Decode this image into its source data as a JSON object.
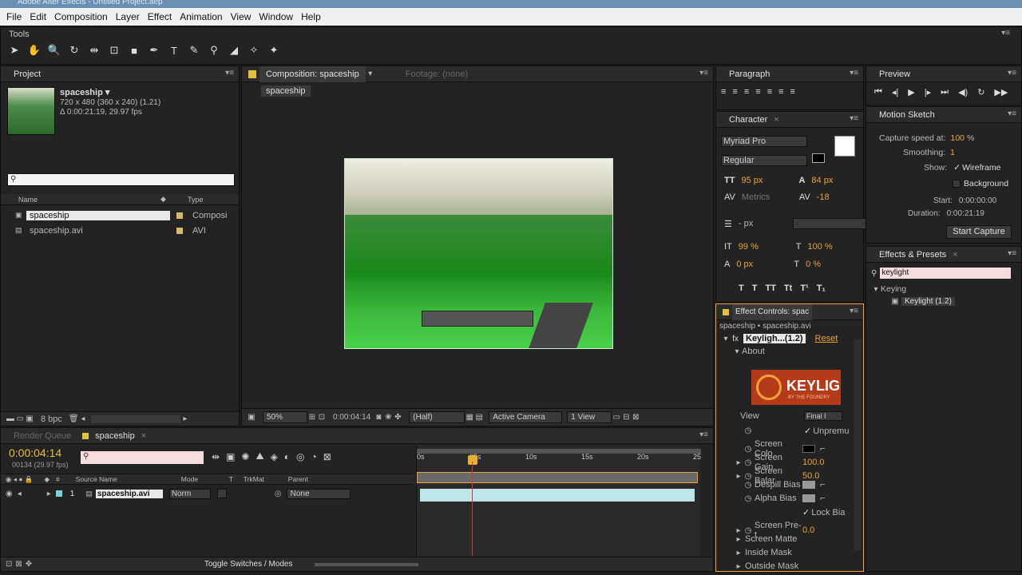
{
  "app": {
    "title": "Adobe After Effects - Untitled Project.aep"
  },
  "menu": [
    "File",
    "Edit",
    "Composition",
    "Layer",
    "Effect",
    "Animation",
    "View",
    "Window",
    "Help"
  ],
  "tools": {
    "title": "Tools"
  },
  "project": {
    "tab": "Project",
    "item_name": "spaceship ▾",
    "item_info1": "720 x 480  (360 x 240) (1.21)",
    "item_info2": "Δ 0:00:21:19, 29.97 fps",
    "search_icon": "search-icon",
    "col_name": "Name",
    "col_type": "Type",
    "rows": [
      {
        "name": "spaceship",
        "type": "Composi"
      },
      {
        "name": "spaceship.avi",
        "type": "AVI"
      }
    ],
    "bpc": "8 bpc"
  },
  "comp": {
    "tab": "Composition: spaceship",
    "footage_tab": "Footage: (none)",
    "crumb": "spaceship",
    "zoom": "50%",
    "timecode": "0:00:04:14",
    "resolution": "(Half)",
    "camera": "Active Camera",
    "view": "1 View"
  },
  "paragraph": {
    "tab": "Paragraph"
  },
  "character": {
    "tab": "Character",
    "font": "Myriad Pro",
    "style": "Regular",
    "size": "95 px",
    "leading": "84 px",
    "kerning": "Metrics",
    "tracking": "-18",
    "stroke": "- px",
    "vscale": "99 %",
    "hscale": "100 %",
    "baseline": "0 px",
    "tsume": "0 %",
    "styles": [
      "T",
      "T",
      "TT",
      "Tt",
      "T¹",
      "T₁"
    ]
  },
  "effect_controls": {
    "tab": "Effect Controls: spac",
    "crumb": "spaceship • spaceship.avi",
    "fx_name": "Keyligh...(1.2)",
    "reset": "Reset",
    "about": "About",
    "logo": "KEYLIG",
    "logo_sub": "BY THE FOUNDRY",
    "view_label": "View",
    "view_value": "Final I",
    "unpremultiply": "Unpremu",
    "rows": [
      {
        "label": "Screen Colo",
        "value": ""
      },
      {
        "label": "Screen Gain",
        "value": "100.0"
      },
      {
        "label": "Screen Balar",
        "value": "50.0"
      },
      {
        "label": "Despill Bias",
        "value": ""
      },
      {
        "label": "Alpha Bias",
        "value": ""
      }
    ],
    "lock_bias": "Lock Bia",
    "screen_pre": "Screen Pre-t",
    "screen_pre_value": "0.0",
    "screen_matte": "Screen Matte",
    "inside_mask": "Inside Mask",
    "outside_mask": "Outside Mask"
  },
  "preview": {
    "tab": "Preview"
  },
  "motion_sketch": {
    "tab": "Motion Sketch",
    "capture_label": "Capture speed at:",
    "capture_value": "100",
    "capture_unit": "%",
    "smoothing_label": "Smoothing:",
    "smoothing_value": "1",
    "show_label": "Show:",
    "wireframe": "Wireframe",
    "background": "Background",
    "start_label": "Start:",
    "start_value": "0:00:00:00",
    "duration_label": "Duration:",
    "duration_value": "0:00:21:19",
    "button": "Start Capture"
  },
  "effects_presets": {
    "tab": "Effects & Presets",
    "search": "keylight",
    "group": "Keying",
    "item": "Keylight (1.2)"
  },
  "timeline": {
    "render_tab": "Render Queue",
    "comp_tab": "spaceship",
    "timecode": "0:00:04:14",
    "frames": "00134 (29.97 fps)",
    "col_source": "Source Name",
    "col_mode": "Mode",
    "col_t": "T",
    "col_trkmat": "TrkMat",
    "col_parent": "Parent",
    "layer_num": "1",
    "layer_name": "spaceship.avi",
    "layer_mode": "Norm",
    "layer_parent": "None",
    "ruler": [
      "0s",
      "05s",
      "10s",
      "15s",
      "20s",
      "25"
    ],
    "toggle": "Toggle Switches / Modes",
    "hash": "#"
  }
}
